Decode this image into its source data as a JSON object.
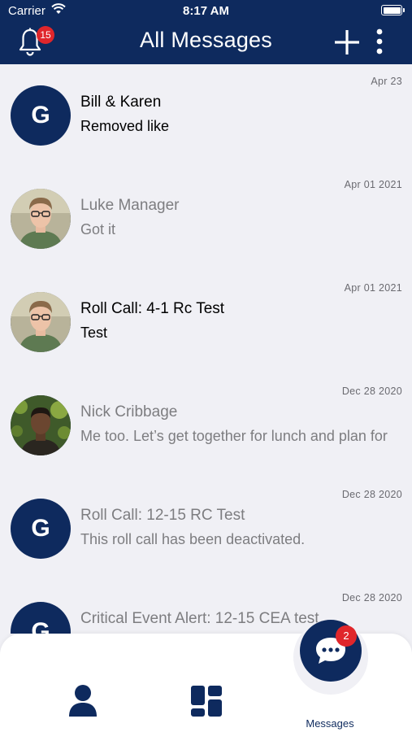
{
  "status_bar": {
    "carrier": "Carrier",
    "time": "8:17 AM"
  },
  "header": {
    "title": "All Messages",
    "notification_count": "15",
    "icons": {
      "bell": "bell-icon",
      "add": "plus-icon",
      "more": "more-vertical-icon"
    }
  },
  "messages": [
    {
      "date": "Apr 23",
      "title": "Bill & Karen",
      "subtitle": "Removed like",
      "avatar_letter": "G",
      "avatar_type": "letter",
      "unread": true
    },
    {
      "date": "Apr 01 2021",
      "title": "Luke Manager",
      "subtitle": "Got it",
      "avatar_type": "photo",
      "unread": false
    },
    {
      "date": "Apr 01 2021",
      "title": "Roll Call: 4-1 Rc Test",
      "subtitle": "Test",
      "avatar_type": "photo",
      "unread": true
    },
    {
      "date": "Dec 28 2020",
      "title": "Nick Cribbage",
      "subtitle": "Me too. Let’s get together for lunch and plan for",
      "avatar_type": "photo",
      "unread": false
    },
    {
      "date": "Dec 28 2020",
      "title": "Roll Call: 12-15 RC Test",
      "subtitle": "This roll call has been deactivated.",
      "avatar_letter": "G",
      "avatar_type": "letter",
      "unread": false
    },
    {
      "date": "Dec 28 2020",
      "title": "Critical Event Alert: 12-15 CEA test",
      "subtitle": "",
      "avatar_letter": "G",
      "avatar_type": "letter",
      "unread": false
    }
  ],
  "tabbar": {
    "messages_label": "Messages",
    "messages_badge": "2",
    "icons": {
      "profile": "person-icon",
      "dashboard": "dashboard-icon",
      "messages": "chat-bubble-icon"
    }
  },
  "colors": {
    "brand": "#0e2a5e",
    "badge": "#e0262b",
    "background": "#f0f0f5"
  }
}
